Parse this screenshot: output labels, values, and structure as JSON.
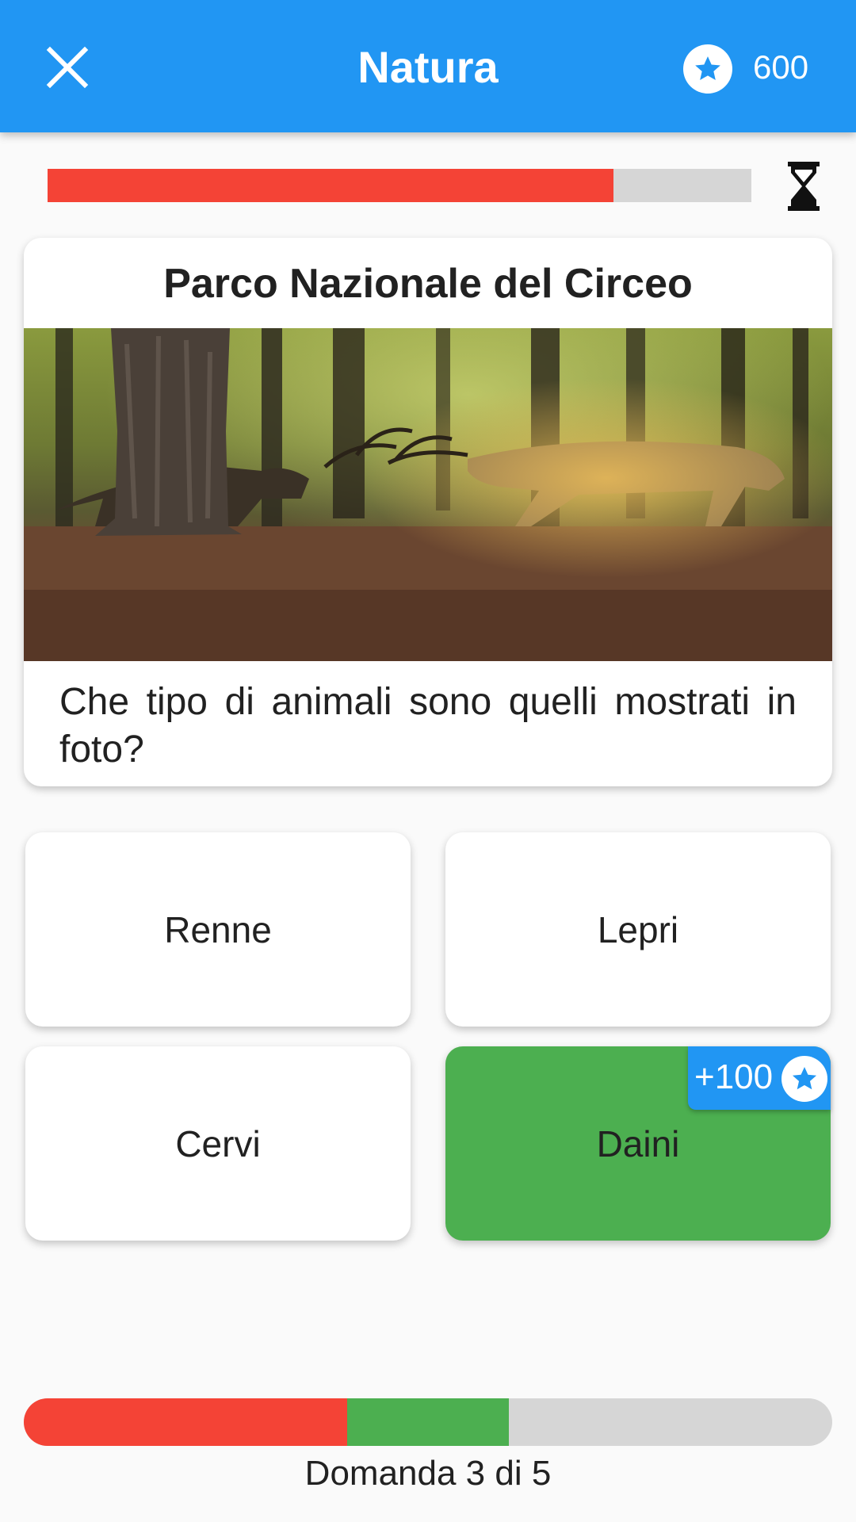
{
  "appbar": {
    "title": "Natura",
    "close_icon": "close-icon",
    "score_icon": "star-icon",
    "score": "600",
    "color": "#2196f3"
  },
  "timer": {
    "remaining_fraction": 0.804,
    "fill_color": "#f44336",
    "track_color": "#d6d6d6",
    "icon": "hourglass-icon"
  },
  "question": {
    "title": "Parco Nazionale del Circeo",
    "photo_description": "photo",
    "text": "Che tipo di animali sono quelli mostrati in foto?"
  },
  "answers": [
    {
      "label": "Renne",
      "state": "default"
    },
    {
      "label": "Lepri",
      "state": "default"
    },
    {
      "label": "Cervi",
      "state": "default"
    },
    {
      "label": "Daini",
      "state": "correct",
      "bonus": "+100"
    }
  ],
  "progress": {
    "segments": [
      {
        "state": "wrong"
      },
      {
        "state": "wrong"
      },
      {
        "state": "correct"
      },
      {
        "state": "pending"
      },
      {
        "state": "pending"
      }
    ],
    "label": "Domanda 3 di 5",
    "correct_color": "#4caf50",
    "wrong_color": "#f44336"
  }
}
